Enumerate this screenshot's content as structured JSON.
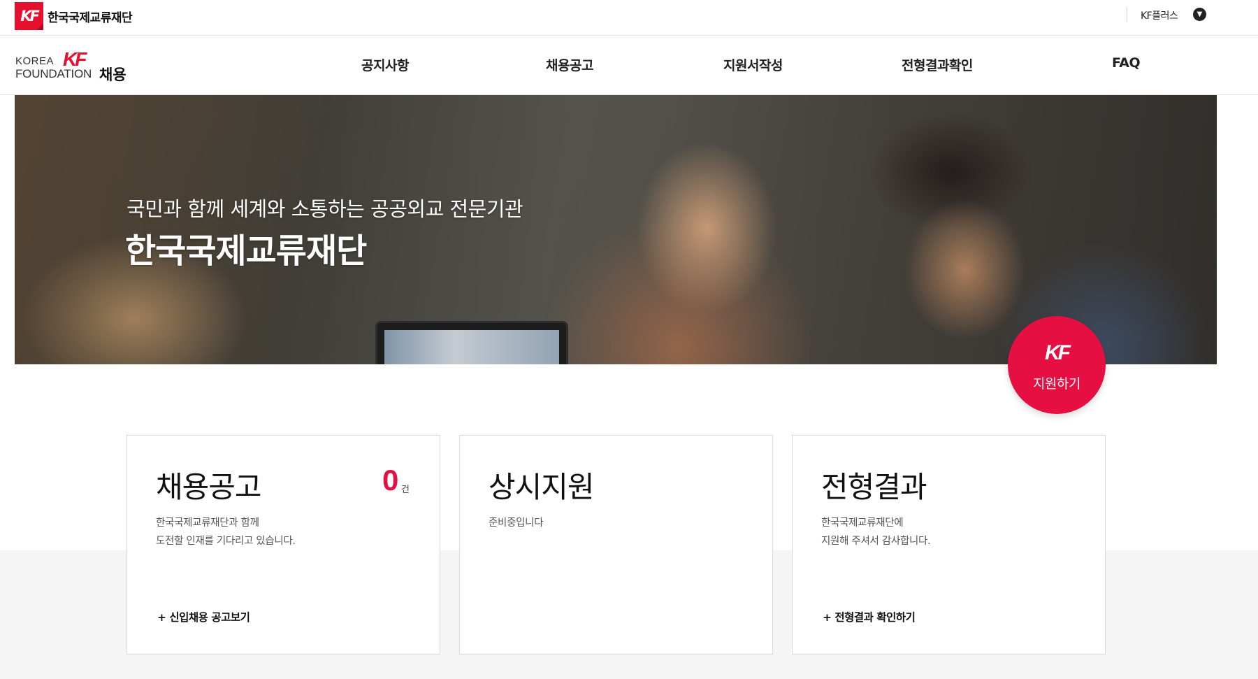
{
  "topbar": {
    "logo_text": "KF",
    "org_name": "한국국제교류재단",
    "kfplus_label": "KF플러스",
    "kfplus_toggle_icon": "chevron-down-icon"
  },
  "brand": {
    "line1": "KOREA",
    "line2": "FOUNDATION",
    "kf": "KF",
    "sub": "채용"
  },
  "nav": {
    "items": [
      {
        "label": "공지사항"
      },
      {
        "label": "채용공고"
      },
      {
        "label": "지원서작성"
      },
      {
        "label": "전형결과확인"
      },
      {
        "label": "FAQ"
      }
    ]
  },
  "hero": {
    "subtitle": "국민과 함께 세계와 소통하는 공공외교 전문기관",
    "title": "한국국제교류재단"
  },
  "apply": {
    "logo": "KF",
    "label": "지원하기"
  },
  "cards": [
    {
      "title": "채용공고",
      "count": "0",
      "count_unit": "건",
      "desc": [
        "한국국제교류재단과 함께",
        "도전할 인재를 기다리고 있습니다."
      ],
      "link": "+ 신입채용 공고보기"
    },
    {
      "title": "상시지원",
      "desc": [
        "준비중입니다"
      ]
    },
    {
      "title": "전형결과",
      "desc": [
        "한국국제교류재단에",
        "지원해 주셔서 감사합니다."
      ],
      "link": "+ 전형결과 확인하기"
    }
  ],
  "colors": {
    "brand_red": "#e60f2d",
    "accent_pink": "#e60f41",
    "band_gray": "#f5f5f5"
  }
}
